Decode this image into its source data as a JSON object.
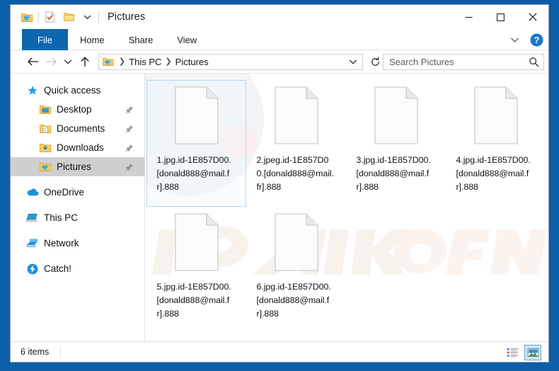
{
  "window": {
    "title": "Pictures",
    "quick_access_toolbar": [
      {
        "name": "properties-icon",
        "label": "Properties"
      },
      {
        "name": "checkbox-document-icon",
        "label": "Rename"
      },
      {
        "name": "new-folder-icon",
        "label": "New folder"
      },
      {
        "name": "chevron-down-icon",
        "label": "Customize Quick Access Toolbar"
      }
    ],
    "controls": {
      "minimize": "─",
      "maximize": "□",
      "close": "✕"
    }
  },
  "ribbon": {
    "tabs": [
      {
        "label": "File",
        "active": true
      },
      {
        "label": "Home",
        "active": false
      },
      {
        "label": "Share",
        "active": false
      },
      {
        "label": "View",
        "active": false
      }
    ],
    "collapse_label": "Minimize the Ribbon",
    "help_label": "Help"
  },
  "address": {
    "back_label": "Back",
    "forward_label": "Forward",
    "recent_label": "Recent locations",
    "up_label": "Up",
    "breadcrumbs": [
      "This PC",
      "Pictures"
    ],
    "dropdown_label": "Previous locations",
    "refresh_label": "Refresh"
  },
  "search": {
    "placeholder": "Search Pictures",
    "icon": "search-icon"
  },
  "sidebar": {
    "items": [
      {
        "label": "Quick access",
        "icon": "star-icon",
        "indent": false,
        "pinned": false,
        "selected": false
      },
      {
        "label": "Desktop",
        "icon": "desktop-folder-icon",
        "indent": true,
        "pinned": true,
        "selected": false
      },
      {
        "label": "Documents",
        "icon": "documents-folder-icon",
        "indent": true,
        "pinned": true,
        "selected": false
      },
      {
        "label": "Downloads",
        "icon": "downloads-folder-icon",
        "indent": true,
        "pinned": true,
        "selected": false
      },
      {
        "label": "Pictures",
        "icon": "pictures-folder-icon",
        "indent": true,
        "pinned": true,
        "selected": true
      },
      {
        "label": "OneDrive",
        "icon": "onedrive-cloud-icon",
        "indent": false,
        "pinned": false,
        "selected": false,
        "gap_before": true
      },
      {
        "label": "This PC",
        "icon": "this-pc-icon",
        "indent": false,
        "pinned": false,
        "selected": false,
        "gap_before": true
      },
      {
        "label": "Network",
        "icon": "network-icon",
        "indent": false,
        "pinned": false,
        "selected": false,
        "gap_before": true
      },
      {
        "label": "Catch!",
        "icon": "catch-icon",
        "indent": false,
        "pinned": false,
        "selected": false,
        "gap_before": true
      }
    ]
  },
  "files": [
    {
      "name": "1.jpg.id-1E857D00.[donald888@mail.fr].888",
      "icon": "blank-document-icon",
      "selected": true
    },
    {
      "name": "2.jpeg.id-1E857D00.[donald888@mail.fr].888",
      "icon": "blank-document-icon",
      "selected": false
    },
    {
      "name": "3.jpg.id-1E857D00.[donald888@mail.fr].888",
      "icon": "blank-document-icon",
      "selected": false
    },
    {
      "name": "4.jpg.id-1E857D00.[donald888@mail.fr].888",
      "icon": "blank-document-icon",
      "selected": false
    },
    {
      "name": "5.jpg.id-1E857D00.[donald888@mail.fr].888",
      "icon": "blank-document-icon",
      "selected": false
    },
    {
      "name": "6.jpg.id-1E857D00.[donald888@mail.fr].888",
      "icon": "blank-document-icon",
      "selected": false
    }
  ],
  "statusbar": {
    "item_count": "6 items",
    "views": [
      {
        "name": "details-view-button",
        "label": "Details view",
        "active": false
      },
      {
        "name": "large-icons-view-button",
        "label": "Large icons view",
        "active": true
      }
    ]
  },
  "colors": {
    "desktop": "#0c5ea9",
    "file_tab": "#0d66b0",
    "selection": "#cfcfcf",
    "accent": "#0078d7",
    "item_selected_border": "#b5d9f0"
  }
}
